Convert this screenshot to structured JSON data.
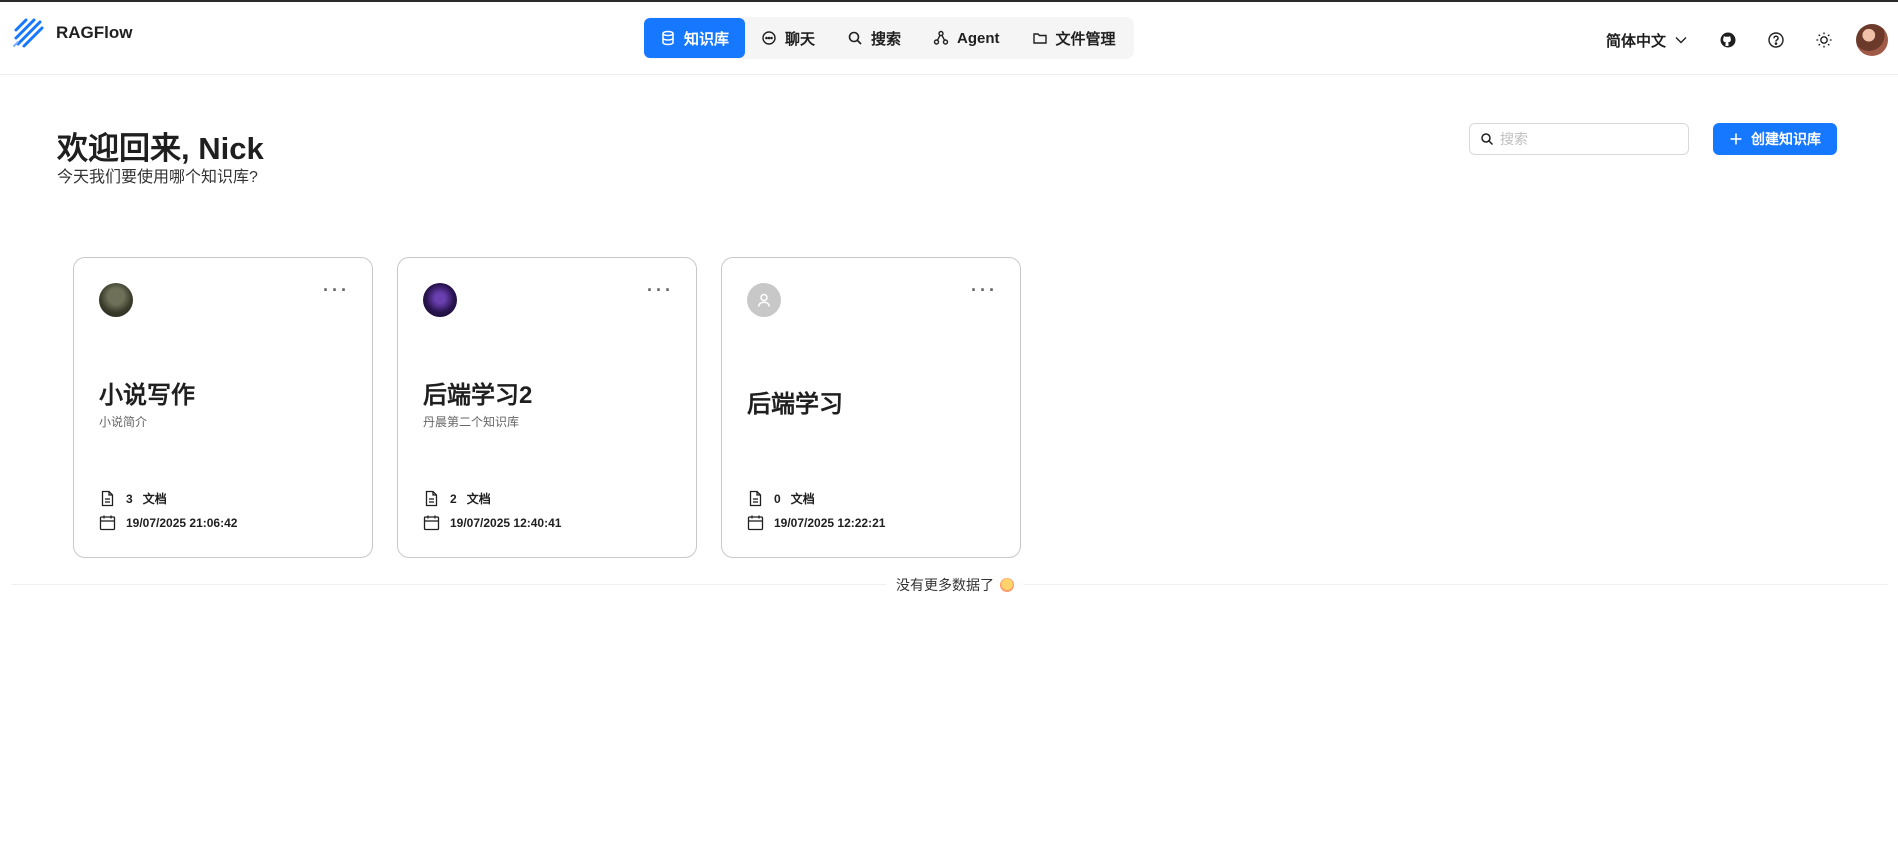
{
  "app": {
    "name": "RAGFlow",
    "accent": "#1677ff"
  },
  "nav": {
    "items": [
      {
        "label": "知识库",
        "icon": "database-icon",
        "active": true
      },
      {
        "label": "聊天",
        "icon": "chat-bubble-icon",
        "active": false
      },
      {
        "label": "搜索",
        "icon": "search-icon",
        "active": false
      },
      {
        "label": "Agent",
        "icon": "agent-graph-icon",
        "active": false
      },
      {
        "label": "文件管理",
        "icon": "folder-icon",
        "active": false
      }
    ]
  },
  "header": {
    "language": "简体中文",
    "tools": [
      "github-icon",
      "help-icon",
      "theme-toggle-icon"
    ]
  },
  "main": {
    "welcome": "欢迎回来, Nick",
    "subtitle": "今天我们要使用哪个知识库?",
    "search_placeholder": "搜索",
    "create_label": "创建知识库",
    "no_more": "没有更多数据了"
  },
  "cards": [
    {
      "title": "小说写作",
      "description": "小说简介",
      "doc_count": "3",
      "doc_label": "文档",
      "date": "19/07/2025 21:06:42"
    },
    {
      "title": "后端学习2",
      "description": "丹晨第二个知识库",
      "doc_count": "2",
      "doc_label": "文档",
      "date": "19/07/2025 12:40:41"
    },
    {
      "title": "后端学习",
      "description": "",
      "doc_count": "0",
      "doc_label": "文档",
      "date": "19/07/2025 12:22:21"
    }
  ]
}
